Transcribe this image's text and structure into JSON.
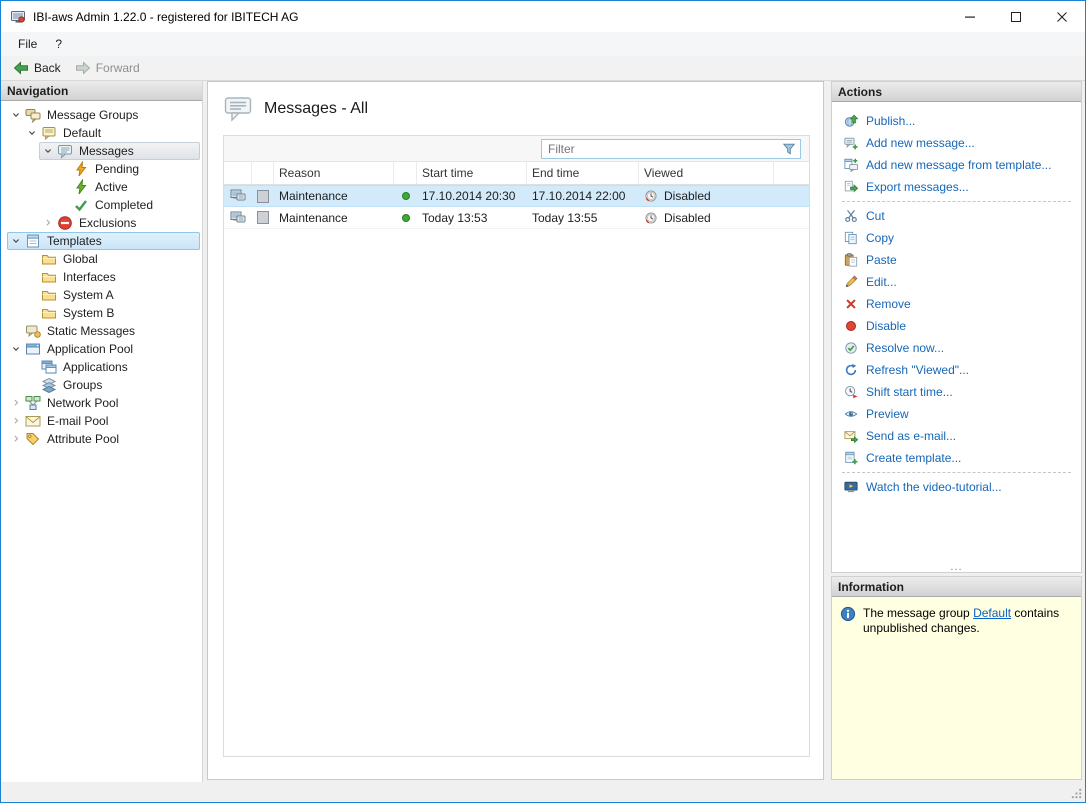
{
  "window": {
    "title": "IBI-aws Admin 1.22.0 - registered for IBITECH AG"
  },
  "menu": {
    "items": [
      {
        "label": "File"
      },
      {
        "label": "?"
      }
    ]
  },
  "toolbar": {
    "back": {
      "label": "Back",
      "enabled": true
    },
    "forward": {
      "label": "Forward",
      "enabled": false
    }
  },
  "navigation": {
    "header": "Navigation",
    "tree": [
      {
        "label": "Message Groups",
        "icon": "message-groups-icon",
        "level": 0,
        "expander": "expanded"
      },
      {
        "label": "Default",
        "icon": "message-group-default-icon",
        "level": 1,
        "expander": "expanded"
      },
      {
        "label": "Messages",
        "icon": "messages-icon",
        "level": 2,
        "expander": "expanded",
        "state": "selected"
      },
      {
        "label": "Pending",
        "icon": "pending-messages-icon",
        "level": 3,
        "expander": "none"
      },
      {
        "label": "Active",
        "icon": "active-messages-icon",
        "level": 3,
        "expander": "none"
      },
      {
        "label": "Completed",
        "icon": "completed-messages-icon",
        "level": 3,
        "expander": "none"
      },
      {
        "label": "Exclusions",
        "icon": "exclusions-icon",
        "level": 2,
        "expander": "collapsed"
      },
      {
        "label": "Templates",
        "icon": "templates-icon",
        "level": 0,
        "expander": "expanded",
        "state": "highlighted"
      },
      {
        "label": "Global",
        "icon": "folder-icon",
        "level": 1,
        "expander": "none"
      },
      {
        "label": "Interfaces",
        "icon": "folder-icon",
        "level": 1,
        "expander": "none"
      },
      {
        "label": "System A",
        "icon": "folder-icon",
        "level": 1,
        "expander": "none"
      },
      {
        "label": "System B",
        "icon": "folder-icon",
        "level": 1,
        "expander": "none"
      },
      {
        "label": "Static Messages",
        "icon": "static-messages-icon",
        "level": 0,
        "expander": "none"
      },
      {
        "label": "Application Pool",
        "icon": "application-pool-icon",
        "level": 0,
        "expander": "expanded"
      },
      {
        "label": "Applications",
        "icon": "applications-icon",
        "level": 1,
        "expander": "none"
      },
      {
        "label": "Groups",
        "icon": "groups-icon",
        "level": 1,
        "expander": "none"
      },
      {
        "label": "Network Pool",
        "icon": "network-pool-icon",
        "level": 0,
        "expander": "collapsed"
      },
      {
        "label": "E-mail Pool",
        "icon": "email-pool-icon",
        "level": 0,
        "expander": "collapsed"
      },
      {
        "label": "Attribute Pool",
        "icon": "attribute-pool-icon",
        "level": 0,
        "expander": "collapsed"
      }
    ]
  },
  "content": {
    "title": "Messages - All",
    "title_icon": "messages-bubble-icon",
    "filter": {
      "placeholder": "Filter",
      "icon": "filter-funnel-icon"
    },
    "table": {
      "headers": [
        {
          "label": ""
        },
        {
          "label": ""
        },
        {
          "label": "Reason"
        },
        {
          "label": ""
        },
        {
          "label": "Start time"
        },
        {
          "label": "End time"
        },
        {
          "label": "Viewed"
        }
      ],
      "rows": [
        {
          "icon": "message-row-icon",
          "reason": "Maintenance",
          "status": "green",
          "start_time": "17.10.2014 20:30",
          "end_time": "17.10.2014 22:00",
          "viewed": "Disabled",
          "selected": true
        },
        {
          "icon": "message-row-icon",
          "reason": "Maintenance",
          "status": "green",
          "start_time": "Today 13:53",
          "end_time": "Today 13:55",
          "viewed": "Disabled",
          "selected": false
        }
      ]
    }
  },
  "actions": {
    "header": "Actions",
    "items": [
      {
        "label": "Publish...",
        "icon": "publish-icon"
      },
      {
        "label": "Add new message...",
        "icon": "add-message-icon"
      },
      {
        "label": "Add new message from template...",
        "icon": "add-message-from-template-icon"
      },
      {
        "label": "Export messages...",
        "icon": "export-messages-icon"
      },
      {
        "label": "Cut",
        "icon": "cut-icon"
      },
      {
        "label": "Copy",
        "icon": "copy-icon"
      },
      {
        "label": "Paste",
        "icon": "paste-icon"
      },
      {
        "label": "Edit...",
        "icon": "edit-icon"
      },
      {
        "label": "Remove",
        "icon": "remove-icon"
      },
      {
        "label": "Disable",
        "icon": "disable-icon"
      },
      {
        "label": "Resolve now...",
        "icon": "resolve-now-icon"
      },
      {
        "label": "Refresh \"Viewed\"...",
        "icon": "refresh-viewed-icon"
      },
      {
        "label": "Shift start time...",
        "icon": "shift-start-time-icon"
      },
      {
        "label": "Preview",
        "icon": "preview-icon"
      },
      {
        "label": "Send as e-mail...",
        "icon": "send-as-email-icon"
      },
      {
        "label": "Create template...",
        "icon": "create-template-icon"
      },
      {
        "label": "Watch the video-tutorial...",
        "icon": "video-tutorial-icon"
      }
    ],
    "overflow": "..."
  },
  "information": {
    "header": "Information",
    "note": {
      "prefix": "The message group ",
      "link": "Default",
      "suffix": " contains unpublished changes."
    }
  },
  "colors": {
    "window_border": "#1a82d2",
    "action_link": "#1667b8",
    "row_selection": "#d3eafa",
    "info_background": "#ffffe1",
    "status_green": "#3daa35"
  }
}
